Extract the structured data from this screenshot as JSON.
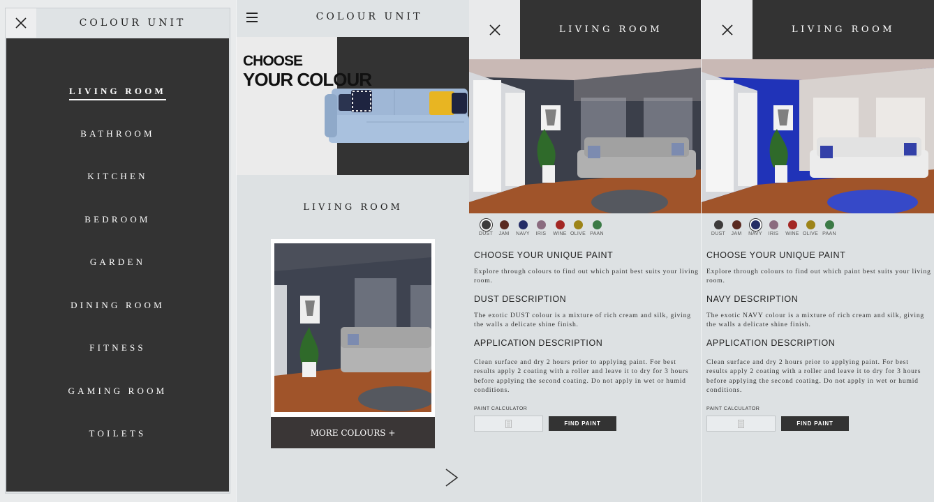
{
  "menu_screen": {
    "brand": "COLOUR UNIT",
    "items": [
      {
        "label": "LIVING ROOM",
        "active": true
      },
      {
        "label": "BATHROOM"
      },
      {
        "label": "KITCHEN"
      },
      {
        "label": "BEDROOM"
      },
      {
        "label": "GARDEN"
      },
      {
        "label": "DINING ROOM"
      },
      {
        "label": "FITNESS"
      },
      {
        "label": "GAMING ROOM"
      },
      {
        "label": "TOILETS"
      }
    ]
  },
  "home_screen": {
    "brand": "COLOUR UNIT",
    "hero_line1": "CHOOSE",
    "hero_line2": "YOUR COLOUR",
    "section_title": "LIVING ROOM",
    "more_button": "MORE COLOURS +"
  },
  "swatches": [
    {
      "name": "DUST",
      "color": "#3d3b3b"
    },
    {
      "name": "JAM",
      "color": "#5a2a20"
    },
    {
      "name": "NAVY",
      "color": "#242c66"
    },
    {
      "name": "IRIS",
      "color": "#8a6b7f"
    },
    {
      "name": "WINE",
      "color": "#a32724"
    },
    {
      "name": "OLIVE",
      "color": "#9d8418"
    },
    {
      "name": "PAAN",
      "color": "#3b7a46"
    }
  ],
  "detail_dust": {
    "title": "LIVING ROOM",
    "selected": "DUST",
    "heading1": "CHOOSE YOUR UNIQUE PAINT",
    "text1": "Explore through colours to find out which paint best suits your living room.",
    "heading2": "DUST DESCRIPTION",
    "text2": "The exotic DUST colour is a mixture of rich cream and silk, giving the walls a delicate shine finish.",
    "heading3": "APPLICATION DESCRIPTION",
    "text3": "Clean surface and dry 2 hours prior to applying paint. For best results apply 2 coating with a roller and leave it to dry for 3 hours before applying the second coating. Do not apply in wet or humid conditions.",
    "calc_label": "PAINT CALCULATOR",
    "find_button": "FIND PAINT"
  },
  "detail_navy": {
    "title": "LIVING ROOM",
    "selected": "NAVY",
    "heading1": "CHOOSE YOUR UNIQUE PAINT",
    "text1": "Explore through colours to find out which paint best suits your living room.",
    "heading2": "NAVY DESCRIPTION",
    "text2": "The exotic NAVY colour is a mixture of rich cream and silk, giving the walls a delicate shine finish.",
    "heading3": "APPLICATION DESCRIPTION",
    "text3": "Clean surface and dry 2 hours prior to applying paint. For best results apply 2 coating with a roller and leave it to dry for 3 hours before applying the second coating. Do not apply in wet or humid conditions.",
    "calc_label": "PAINT CALCULATOR",
    "find_button": "FIND PAINT"
  },
  "colors": {
    "dark": "#333333",
    "wall_dust": "#3b3f4a",
    "wall_navy": "#1f2fb0",
    "floor": "#a0542a"
  }
}
